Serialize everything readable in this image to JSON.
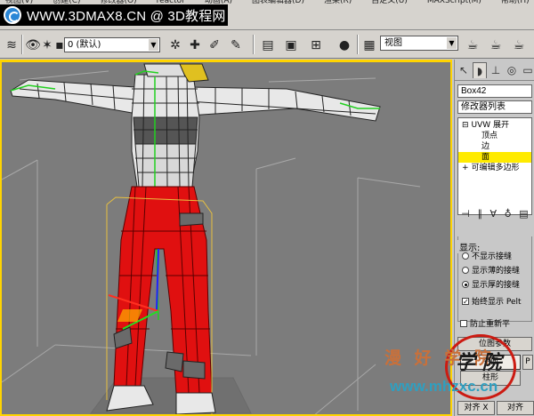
{
  "banner": {
    "menu_items": [
      "视图(V)",
      "创建(C)",
      "修改器(O)",
      "reactor",
      "动画(A)",
      "图表编辑器(D)",
      "渲染(R)",
      "自定义(U)",
      "MAXScript(M)",
      "帮助(H)"
    ],
    "watermark_text": "WWW.3DMAX8.CN @ 3D教程网"
  },
  "toolbar": {
    "layer_value": "0 (默认)",
    "view_value": "视图"
  },
  "panel": {
    "object_name": "Box42",
    "modifier_list": "修改器列表",
    "stack": [
      {
        "label": "UVW 展开",
        "prefix": "⊟",
        "selected": false
      },
      {
        "label": "顶点",
        "prefix": "",
        "selected": false
      },
      {
        "label": "边",
        "prefix": "",
        "selected": false
      },
      {
        "label": "面",
        "prefix": "",
        "selected": true
      },
      {
        "label": "可编辑多边形",
        "prefix": "+",
        "selected": false
      }
    ],
    "display_rollout": {
      "title": "显示:",
      "options": [
        {
          "label": "不显示接缝",
          "selected": false
        },
        {
          "label": "显示薄的接缝",
          "selected": false
        },
        {
          "label": "显示厚的接缝",
          "selected": true
        }
      ],
      "checkbox_label": "始终显示 Pelt",
      "checkbox_checked": true
    },
    "prevent_label": "防止重新平",
    "map_params_title": "位图参数",
    "planar_label": "平面",
    "cylinder_label": "柱形",
    "align_x_label": "对齐 X",
    "align_y_label": "对齐"
  },
  "brand": {
    "name": "漫 好 学 院",
    "stamp": "学 院",
    "url": "www.mhzxc.cn"
  },
  "colors": {
    "viewport_bg": "#7c7c7c",
    "selection_yellow": "#ffeb00",
    "pants_red": "#e01010",
    "viewport_border": "#ffd400"
  }
}
